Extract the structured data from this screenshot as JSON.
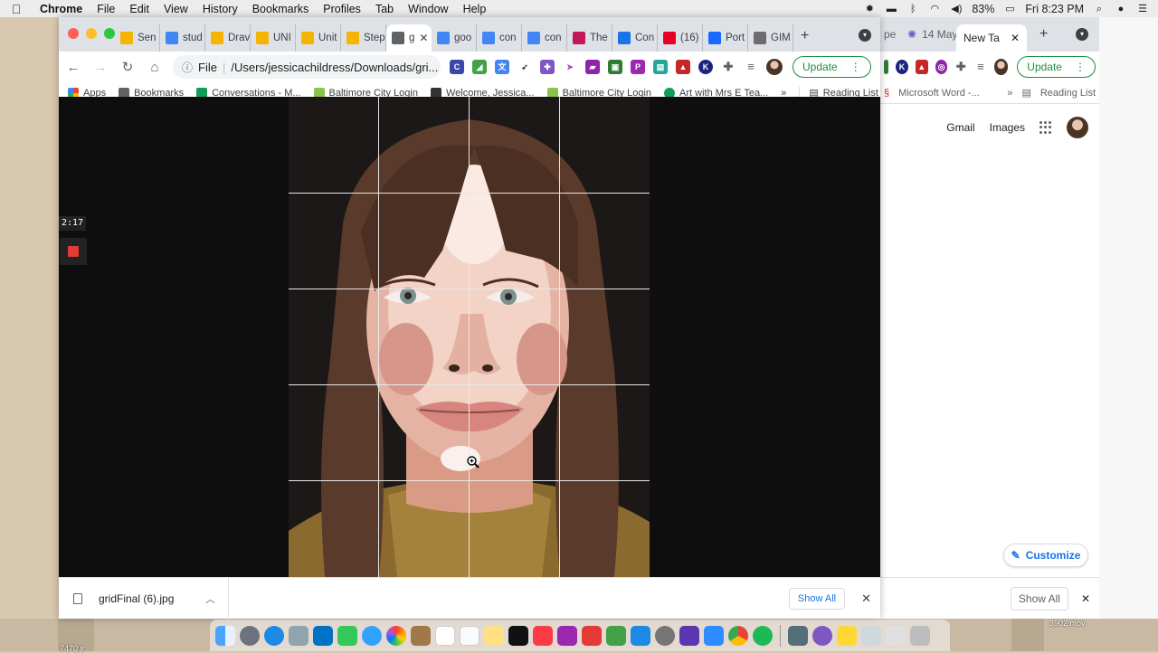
{
  "menubar": {
    "apple": "",
    "app_name": "Chrome",
    "items": [
      "File",
      "Edit",
      "View",
      "History",
      "Bookmarks",
      "Profiles",
      "Tab",
      "Window",
      "Help"
    ],
    "battery": "83%",
    "clock": "Fri 8:23 PM"
  },
  "main_window": {
    "tabs": [
      {
        "label": "Sen",
        "favicon_color": "#f4b400"
      },
      {
        "label": "stud",
        "favicon_color": "#4285f4"
      },
      {
        "label": "Drav",
        "favicon_color": "#f4b400"
      },
      {
        "label": "UNI",
        "favicon_color": "#f4b400"
      },
      {
        "label": "Unit",
        "favicon_color": "#f4b400"
      },
      {
        "label": "Step",
        "favicon_color": "#f4b400"
      },
      {
        "label": "g",
        "favicon_color": "#5f6368",
        "active": true
      },
      {
        "label": "goo",
        "favicon_color": "#4285f4"
      },
      {
        "label": "con",
        "favicon_color": "#4285f4"
      },
      {
        "label": "con",
        "favicon_color": "#4285f4"
      },
      {
        "label": "The",
        "favicon_color": "#c2185b"
      },
      {
        "label": "Con",
        "favicon_color": "#1a73e8"
      },
      {
        "label": "(16)",
        "favicon_color": "#e60023"
      },
      {
        "label": "Port",
        "favicon_color": "#1769ff"
      },
      {
        "label": "GIM",
        "favicon_color": "#6d6d6d"
      }
    ],
    "address": {
      "scheme_label": "File",
      "url": "/Users/jessicachildress/Downloads/gri..."
    },
    "update_label": "Update",
    "bookmarks": [
      {
        "label": "Apps",
        "color": "#ea4335"
      },
      {
        "label": "Bookmarks",
        "color": "#5f6368"
      },
      {
        "label": "Conversations - M...",
        "color": "#0f9d58"
      },
      {
        "label": "Baltimore City Login",
        "color": "#8bc34a"
      },
      {
        "label": "Welcome, Jessica...",
        "color": "#333333"
      },
      {
        "label": "Baltimore City Login",
        "color": "#8bc34a"
      },
      {
        "label": "Art with Mrs E Tea...",
        "color": "#0f9d58"
      }
    ],
    "bookmarks_more": "»",
    "reading_list": "Reading List",
    "recorder": {
      "time": "2:17"
    },
    "download": {
      "filename": "gridFinal (6).jpg",
      "show_all": "Show All"
    }
  },
  "back_window": {
    "tabs": [
      {
        "label": "pe"
      },
      {
        "label": "14 May"
      },
      {
        "label": "New Ta",
        "active": true
      }
    ],
    "update_label": "Update",
    "bookmark": "Microsoft Word -...",
    "bookmarks_more": "»",
    "reading_list": "Reading List",
    "links": [
      "Gmail",
      "Images"
    ],
    "customize": "Customize",
    "show_all": "Show All"
  },
  "desktop": {
    "file_label_left": "7470.jr",
    "file_label_right": "3902.mov"
  },
  "colors": {
    "accent_green": "#1e8e3e",
    "link_blue": "#1a73e8",
    "record_red": "#e53935"
  }
}
